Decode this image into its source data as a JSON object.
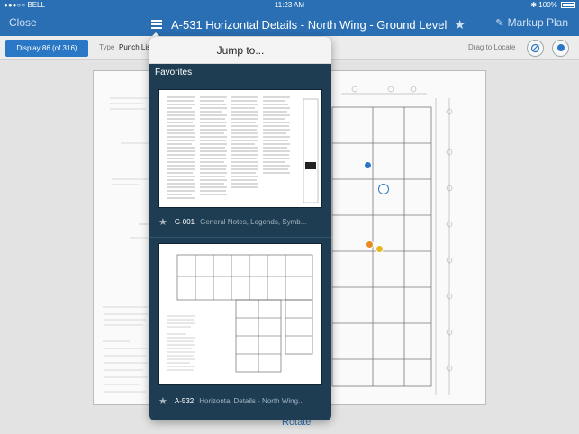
{
  "status_bar": {
    "carrier": "●●●○○ BELL",
    "time": "11:23 AM",
    "battery_text": "100%"
  },
  "nav": {
    "close_label": "Close",
    "title": "A-531 Horizontal Details - North Wing - Ground Level",
    "markup_label": "Markup Plan"
  },
  "toolbar": {
    "display_label": "Display 86 (of 316)",
    "type_label": "Type",
    "type_value": "Punch Lis",
    "drag_locate_label": "Drag to Locate"
  },
  "popover": {
    "header": "Jump to...",
    "section_label": "Favorites",
    "items": [
      {
        "code": "G-001",
        "name": "General Notes, Legends, Symb..."
      },
      {
        "code": "A-532",
        "name": "Horizontal Details - North Wing..."
      }
    ]
  },
  "bottom": {
    "rotate_label": "Rotate"
  },
  "colors": {
    "nav_blue": "#2a6fb3",
    "button_blue": "#2a78c5",
    "popover_bg": "#1e3d52",
    "pin_orange": "#e88a22",
    "pin_yellow": "#e8b522"
  },
  "icons": {
    "list": "list-icon",
    "favorite": "star-icon",
    "markup": "pencil-icon",
    "locate": "crosshair-icon",
    "pin": "pin-icon"
  }
}
